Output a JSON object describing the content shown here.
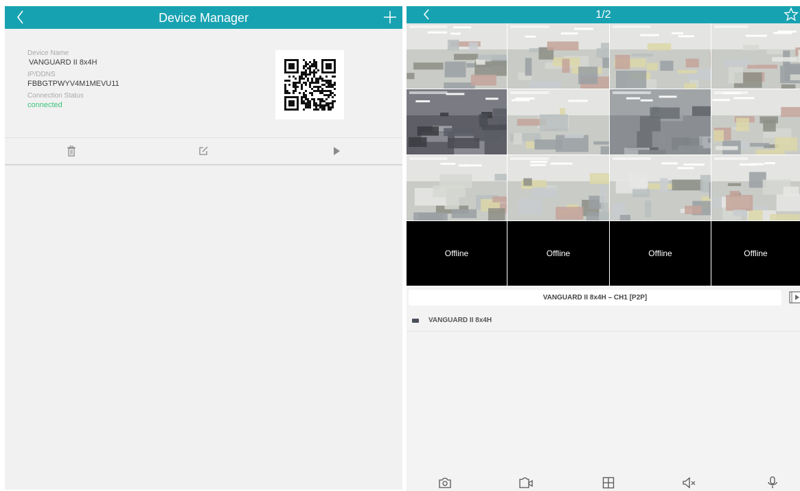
{
  "left": {
    "header": {
      "title": "Device Manager"
    },
    "device": {
      "name_label": "Device Name",
      "name": "VANGUARD II 8x4H",
      "ip_label": "IP/DDNS",
      "ip": "FBBGTPWYV4M1MEVU11",
      "conn_label": "Connection Status",
      "conn": "connected"
    },
    "actions": [
      "trash-icon",
      "edit-icon",
      "play-icon"
    ]
  },
  "right": {
    "header": {
      "page": "1/2"
    },
    "offline_label": "Offline",
    "device_bar": "VANGUARD II 8x4H  –  CH1 [P2P]",
    "device_row": "VANGUARD II 8x4H",
    "toolbar": [
      "camera-icon",
      "record-icon",
      "layout-icon",
      "mute-icon",
      "mic-icon"
    ]
  },
  "colors": {
    "accent": "#17a2b1",
    "connected": "#3cc47c",
    "offline_bg": "#000000"
  }
}
